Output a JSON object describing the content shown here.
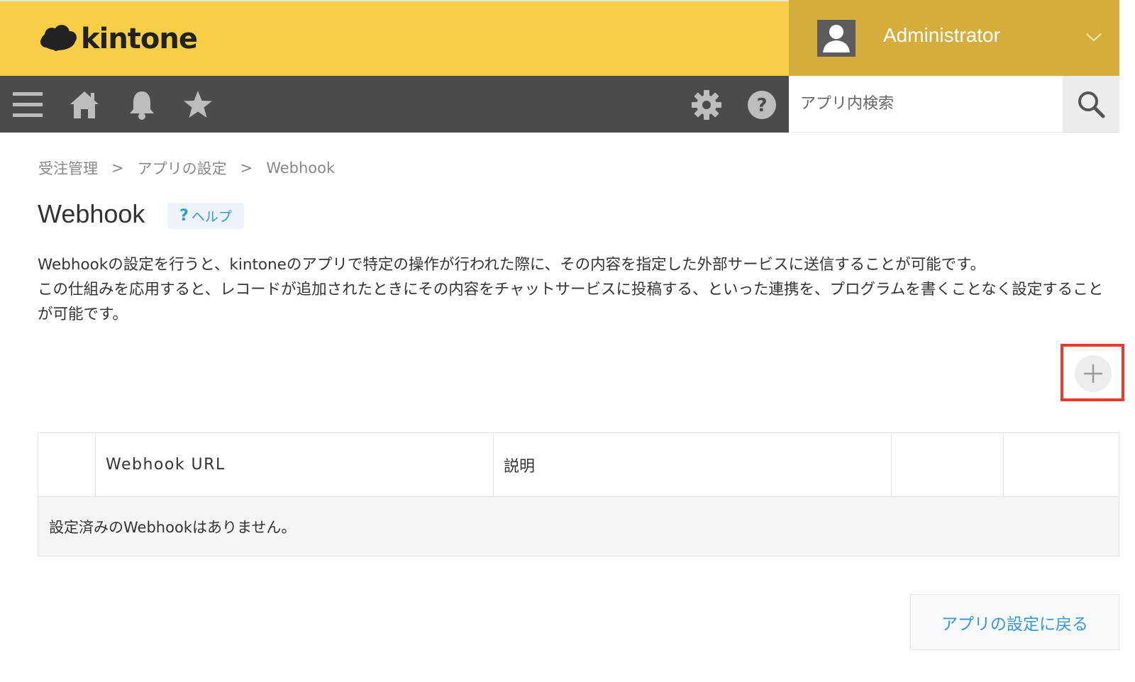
{
  "header": {
    "logo_text": "kintone",
    "user_name": "Administrator",
    "search_placeholder": "アプリ内検索"
  },
  "nav": {
    "icons": [
      "menu-icon",
      "home-icon",
      "bell-icon",
      "star-icon",
      "gear-icon",
      "help-icon"
    ]
  },
  "breadcrumb": {
    "items": [
      "受注管理",
      "アプリの設定",
      "Webhook"
    ],
    "separator": ">"
  },
  "page": {
    "title": "Webhook",
    "help_label": "ヘルプ",
    "help_mark": "?",
    "description_lines": [
      "Webhookの設定を行うと、kintoneのアプリで特定の操作が行われた際に、その内容を指定した外部サービスに送信することが可能です。",
      "この仕組みを応用すると、レコードが追加されたときにその内容をチャットサービスに投稿する、といった連携を、プログラムを書くことなく設定することが可能です。"
    ]
  },
  "table": {
    "columns": [
      "",
      "Webhook URL",
      "説明",
      "",
      ""
    ],
    "empty_message": "設定済みのWebhookはありません。"
  },
  "footer": {
    "back_label": "アプリの設定に戻る"
  },
  "colors": {
    "header_yellow": "#f8ce47",
    "user_area": "#d4ad3d",
    "nav_dark": "#4b4b4b",
    "link_blue": "#3498db",
    "highlight_red": "#e8392b"
  }
}
